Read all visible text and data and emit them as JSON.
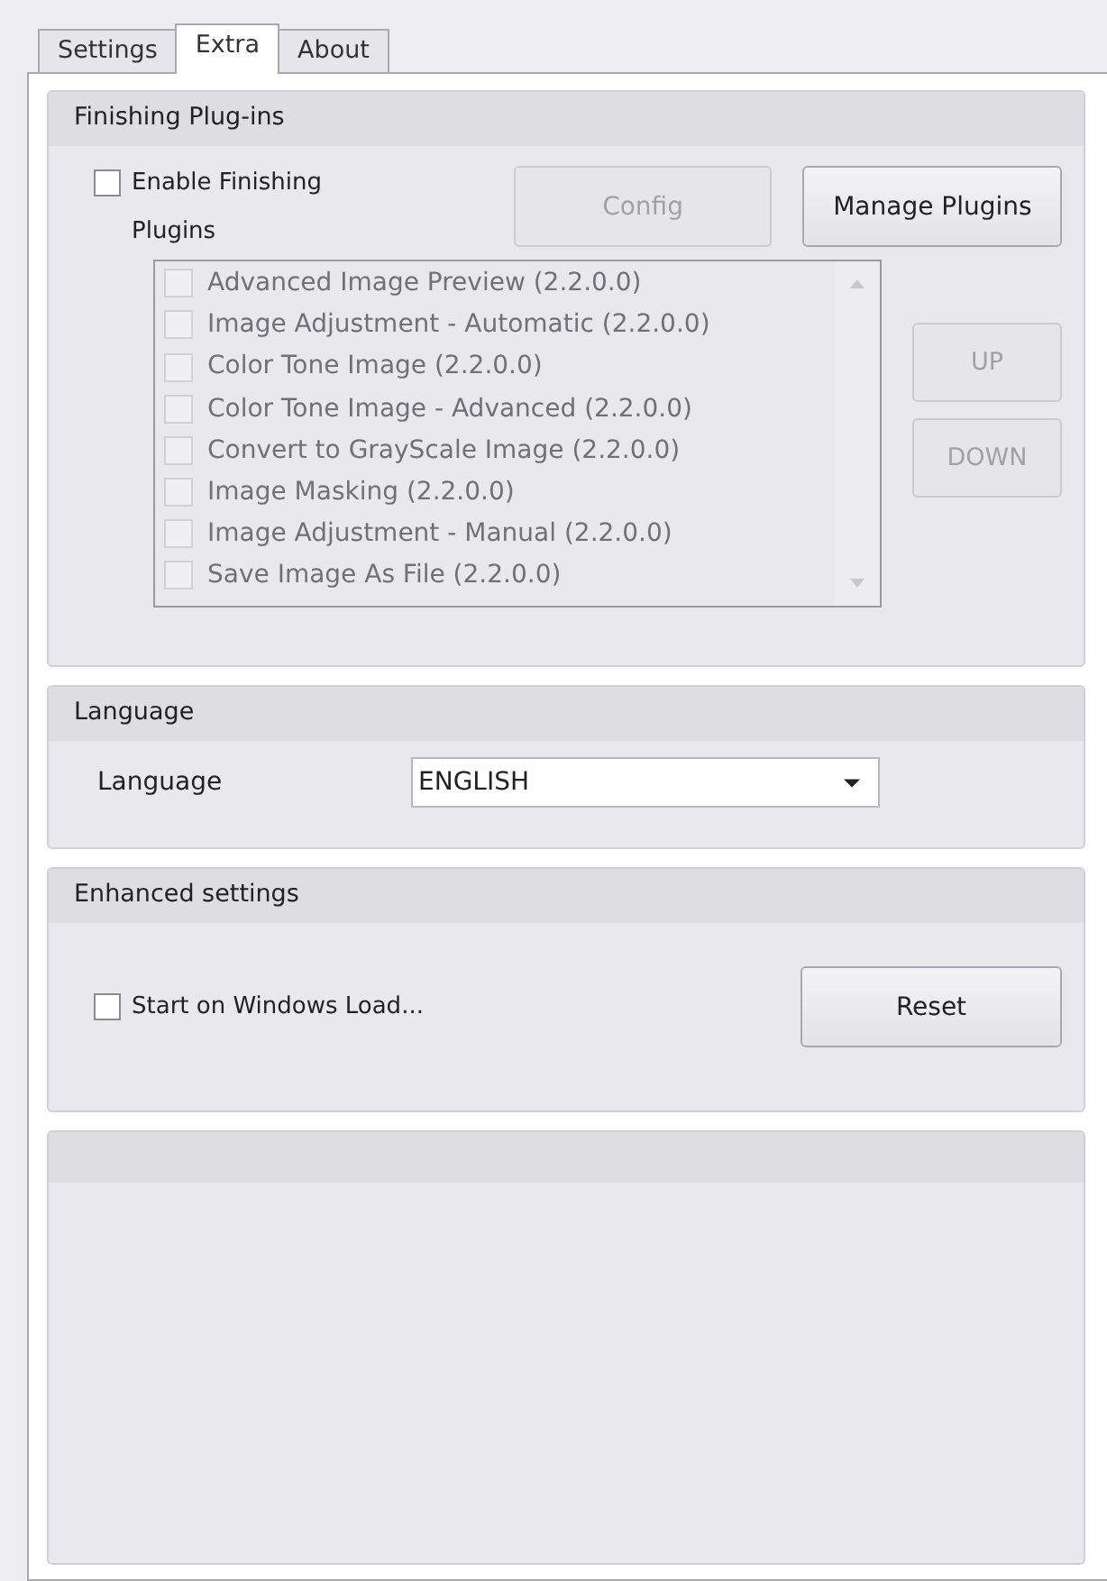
{
  "tabs": [
    {
      "label": "Settings",
      "selected": false
    },
    {
      "label": "Extra",
      "selected": true
    },
    {
      "label": "About",
      "selected": false
    }
  ],
  "finishing": {
    "title": "Finishing Plug-ins",
    "enable": {
      "label": "Enable Finishing Plugins",
      "checked": false
    },
    "buttons": [
      {
        "label": "Config",
        "disabled": true
      },
      {
        "label": "Manage Plugins",
        "disabled": false
      }
    ],
    "plugins": [
      {
        "label": "Advanced Image Preview (2.2.0.0)",
        "checked": false,
        "disabled": true
      },
      {
        "label": "Image Adjustment - Automatic (2.2.0.0)",
        "checked": false,
        "disabled": true
      },
      {
        "label": "Color Tone Image (2.2.0.0)",
        "checked": false,
        "disabled": true
      },
      {
        "label": "Color Tone Image - Advanced (2.2.0.0)",
        "checked": false,
        "disabled": true
      },
      {
        "label": "Convert to GrayScale Image (2.2.0.0)",
        "checked": false,
        "disabled": true
      },
      {
        "label": "Image Masking (2.2.0.0)",
        "checked": false,
        "disabled": true
      },
      {
        "label": "Image Adjustment - Manual (2.2.0.0)",
        "checked": false,
        "disabled": true
      },
      {
        "label": "Save Image As File (2.2.0.0)",
        "checked": false,
        "disabled": true
      }
    ],
    "order_buttons": [
      {
        "label": "UP",
        "disabled": true
      },
      {
        "label": "DOWN",
        "disabled": true
      }
    ]
  },
  "language": {
    "title": "Language",
    "label": "Language",
    "value": "ENGLISH"
  },
  "enhanced": {
    "title": "Enhanced settings",
    "start": {
      "label": "Start on Windows Load...",
      "checked": false
    },
    "reset": "Reset"
  }
}
